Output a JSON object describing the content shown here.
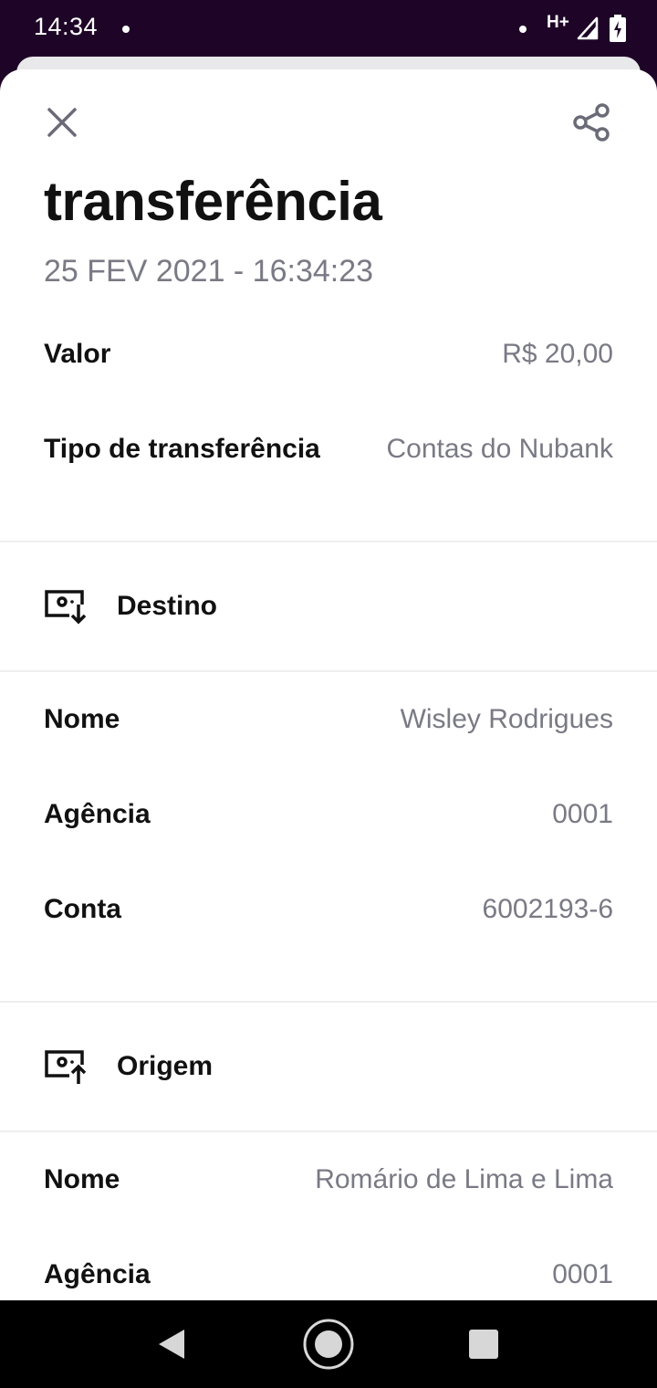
{
  "status_bar": {
    "time": "14:34",
    "network": "H+"
  },
  "header": {
    "close_icon": "close-icon",
    "share_icon": "share-icon",
    "title": "transferência",
    "date": "25 FEV 2021 - 16:34:23"
  },
  "summary": [
    {
      "label": "Valor",
      "value": "R$ 20,00"
    },
    {
      "label": "Tipo de transferência",
      "value": "Contas do Nubank"
    }
  ],
  "destino": {
    "title": "Destino",
    "icon": "money-receive-icon",
    "rows": [
      {
        "label": "Nome",
        "value": "Wisley Rodrigues"
      },
      {
        "label": "Agência",
        "value": "0001"
      },
      {
        "label": "Conta",
        "value": "6002193-6"
      }
    ]
  },
  "origem": {
    "title": "Origem",
    "icon": "money-send-icon",
    "rows": [
      {
        "label": "Nome",
        "value": "Romário de Lima e Lima"
      },
      {
        "label": "Agência",
        "value": "0001"
      }
    ]
  },
  "nav": {
    "back_icon": "nav-back-icon",
    "home_icon": "nav-home-icon",
    "recents_icon": "nav-recents-icon"
  },
  "colors": {
    "status_bar_bg": "#1e0527",
    "label_text": "#111111",
    "value_text": "#7a7a85",
    "divider": "#eeeeee"
  }
}
